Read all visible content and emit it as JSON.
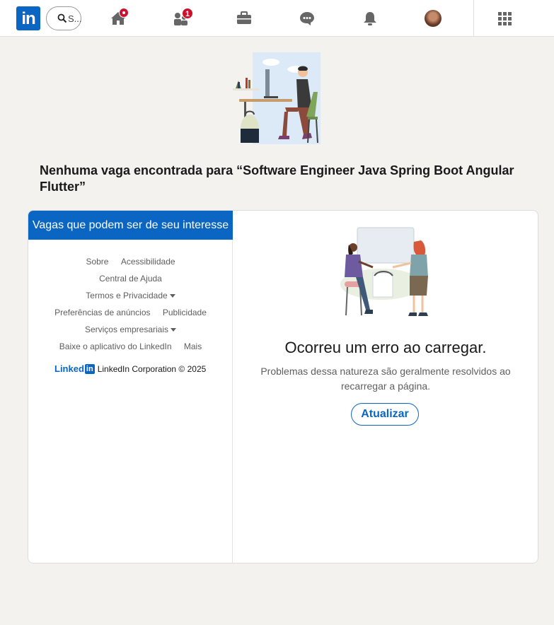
{
  "nav": {
    "logo": "in",
    "search_placeholder": "S...",
    "messaging_badge": "1",
    "accent": "#0a66c2",
    "badge_color": "#cb112d"
  },
  "page": {
    "title": "Nenhuma vaga encontrada para “Software Engineer Java Spring Boot Angular Flutter”"
  },
  "sidebar": {
    "header": "Vagas que podem ser de seu interesse",
    "links": {
      "sobre": "Sobre",
      "acessibilidade": "Acessibilidade",
      "ajuda": "Central de Ajuda",
      "termos": "Termos e Privacidade",
      "preferencias": "Preferências de anúncios",
      "publicidade": "Publicidade",
      "servicos": "Serviços empresariais",
      "aplicativo": "Baixe o aplicativo do LinkedIn",
      "mais": "Mais"
    },
    "brand_word": "Linked",
    "brand_in": "in",
    "copyright": "LinkedIn Corporation © 2025"
  },
  "error": {
    "title": "Ocorreu um erro ao carregar.",
    "description": "Problemas dessa natureza são geralmente resolvidos ao recarregar a página.",
    "button": "Atualizar"
  }
}
